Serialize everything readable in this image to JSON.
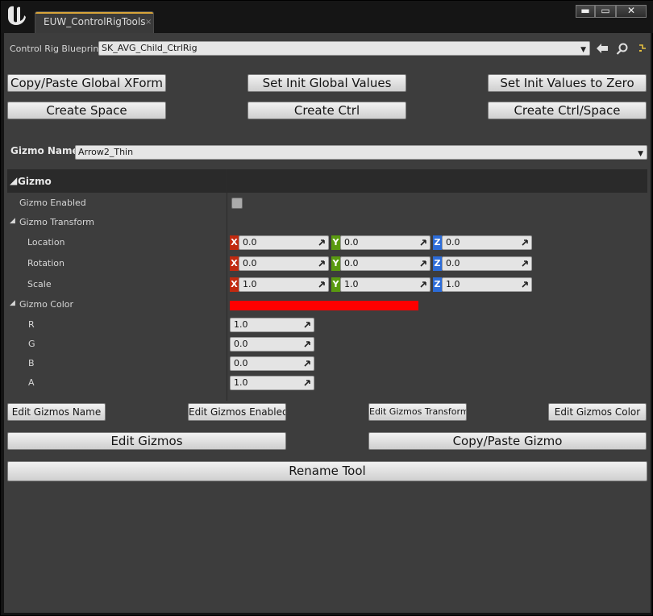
{
  "window": {
    "tab_title": "EUW_ControlRigTools",
    "tab_close": "×",
    "min_label": "▬",
    "max_label": "▭",
    "close_label": "✕"
  },
  "blueprint": {
    "label": "Control Rig Blueprint",
    "value": "SK_AVG_Child_CtrlRig"
  },
  "buttons_row1": {
    "copy_paste_xform": "Copy/Paste Global XForm",
    "set_init_global": "Set Init Global Values",
    "set_init_zero": "Set Init Values to Zero"
  },
  "buttons_row2": {
    "create_space": "Create Space",
    "create_ctrl": "Create Ctrl",
    "create_ctrl_space": "Create Ctrl/Space"
  },
  "gizmo_name": {
    "label": "Gizmo Name",
    "value": "Arrow2_Thin"
  },
  "details": {
    "category": "Gizmo",
    "enabled_label": "Gizmo Enabled",
    "transform_label": "Gizmo Transform",
    "location_label": "Location",
    "rotation_label": "Rotation",
    "scale_label": "Scale",
    "axis_x": "X",
    "axis_y": "Y",
    "axis_z": "Z",
    "location": [
      "0.0",
      "0.0",
      "0.0"
    ],
    "rotation": [
      "0.0",
      "0.0",
      "0.0"
    ],
    "scale": [
      "1.0",
      "1.0",
      "1.0"
    ],
    "color_label": "Gizmo Color",
    "color_hex": "#ff0000",
    "r_label": "R",
    "r_value": "1.0",
    "g_label": "G",
    "g_value": "0.0",
    "b_label": "B",
    "b_value": "0.0",
    "a_label": "A",
    "a_value": "1.0"
  },
  "buttons_row3": {
    "edit_name": "Edit Gizmos Name",
    "edit_enabled": "Edit Gizmos Enabled",
    "edit_transform": "Edit Gizmos Transform",
    "edit_color": "Edit Gizmos Color"
  },
  "buttons_row4": {
    "edit_gizmos": "Edit Gizmos",
    "copy_paste_gizmo": "Copy/Paste Gizmo"
  },
  "rename_tool": "Rename Tool",
  "icons": {
    "logo": "unreal-logo-icon",
    "back": "arrow-left-icon",
    "browse": "magnifier-icon",
    "use": "use-selected-icon"
  }
}
